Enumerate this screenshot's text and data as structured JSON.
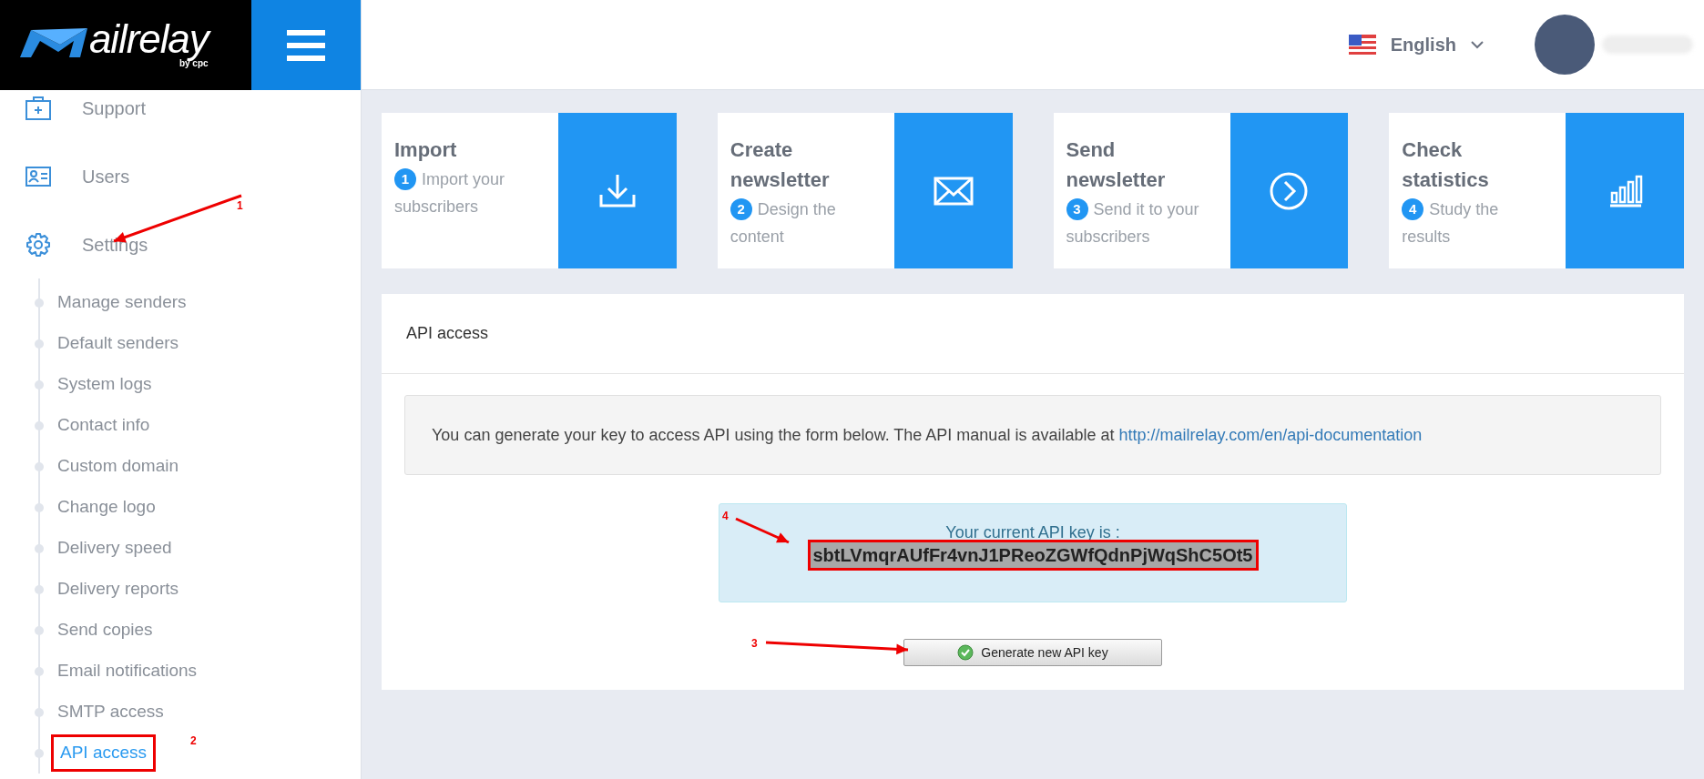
{
  "logo": {
    "text": "ailrelay",
    "byline": "by cpc"
  },
  "header": {
    "language": "English"
  },
  "sidebar": {
    "items": [
      {
        "label": "Support"
      },
      {
        "label": "Users"
      },
      {
        "label": "Settings",
        "annotation": "1",
        "children": [
          {
            "label": "Manage senders",
            "selected": false
          },
          {
            "label": "Default senders",
            "selected": false
          },
          {
            "label": "System logs",
            "selected": false
          },
          {
            "label": "Contact info",
            "selected": false
          },
          {
            "label": "Custom domain",
            "selected": false
          },
          {
            "label": "Change logo",
            "selected": false
          },
          {
            "label": "Delivery speed",
            "selected": false
          },
          {
            "label": "Delivery reports",
            "selected": false
          },
          {
            "label": "Send copies",
            "selected": false
          },
          {
            "label": "Email notifications",
            "selected": false
          },
          {
            "label": "SMTP access",
            "selected": false
          },
          {
            "label": "API access",
            "selected": true,
            "annotation": "2"
          }
        ]
      }
    ]
  },
  "steps": [
    {
      "title": "Import",
      "number": "1",
      "description": "Import your subscribers"
    },
    {
      "title": "Create newsletter",
      "number": "2",
      "description": "Design the content"
    },
    {
      "title": "Send newsletter",
      "number": "3",
      "description": "Send it to your subscribers"
    },
    {
      "title": "Check statistics",
      "number": "4",
      "description": "Study the results"
    }
  ],
  "panel": {
    "title": "API access",
    "info": {
      "text": "You can generate your key to access API using the form below. The API manual is available at",
      "link": "http://mailrelay.com/en/api-documentation"
    },
    "key": {
      "label": "Your current API key is :",
      "value": "sbtLVmqrAUfFr4vnJ1PReoZGWfQdnPjWqShC5Ot5",
      "annotation": "4"
    },
    "button": {
      "label": "Generate new API key",
      "annotation": "3"
    }
  }
}
